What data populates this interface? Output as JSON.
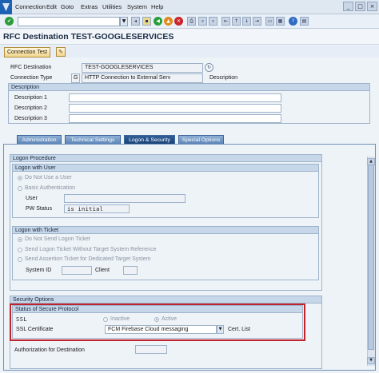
{
  "menu": [
    "Connection",
    "Edit",
    "Goto",
    "Extras",
    "Utilities",
    "System",
    "Help"
  ],
  "window_controls": [
    "minimize-icon",
    "maximize-icon",
    "close-icon"
  ],
  "toolbar": {
    "command_field": "",
    "icons": [
      "enter-icon",
      "save-icon",
      "back-icon",
      "exit-icon",
      "cancel-icon",
      "print-icon",
      "find-icon",
      "find-next-icon",
      "first-page-icon",
      "previous-page-icon",
      "next-page-icon",
      "last-page-icon",
      "new-session-icon",
      "shortcut-icon",
      "help-icon",
      "layout-icon"
    ]
  },
  "title": "RFC Destination TEST-GOOGLESERVICES",
  "app_toolbar": {
    "connection_test": "Connection Test"
  },
  "header": {
    "rfc_destination_label": "RFC Destination",
    "rfc_destination_value": "TEST-GOOGLESERVICES",
    "connection_type_label": "Connection Type",
    "connection_type_code": "G",
    "connection_type_text": "HTTP Connection to External Serv",
    "description_label": "Description"
  },
  "description_group": {
    "title": "Description",
    "fields": [
      {
        "label": "Description 1",
        "value": ""
      },
      {
        "label": "Description 2",
        "value": ""
      },
      {
        "label": "Description 3",
        "value": ""
      }
    ]
  },
  "tabs": [
    {
      "label": "Administration",
      "active": false
    },
    {
      "label": "Technical Settings",
      "active": false
    },
    {
      "label": "Logon & Security",
      "active": true
    },
    {
      "label": "Special Options",
      "active": false
    }
  ],
  "logon_procedure": {
    "title": "Logon Procedure",
    "logon_with_user": {
      "title": "Logon with User",
      "options": [
        {
          "label": "Do Not Use a User",
          "selected": true
        },
        {
          "label": "Basic Authentication",
          "selected": false
        }
      ],
      "user_label": "User",
      "user_value": "",
      "pw_status_label": "PW Status",
      "pw_status_value": "is initial"
    },
    "logon_with_ticket": {
      "title": "Logon with Ticket",
      "options": [
        {
          "label": "Do Not Send Logon Ticket",
          "selected": true
        },
        {
          "label": "Send Logon Ticket Without Target System Reference",
          "selected": false
        },
        {
          "label": "Send Assertion Ticket for Dedicated Target System",
          "selected": false
        }
      ],
      "system_id_label": "System ID",
      "system_id_value": "",
      "client_label": "Client",
      "client_value": ""
    }
  },
  "security_options": {
    "title": "Security Options",
    "status_title": "Status of Secure Protocol",
    "ssl_label": "SSL",
    "ssl_options": [
      {
        "label": "Inactive",
        "selected": false
      },
      {
        "label": "Active",
        "selected": true
      }
    ],
    "ssl_certificate_label": "SSL Certificate",
    "ssl_certificate_value": "FCM Firebase Cloud messaging",
    "cert_list_label": "Cert. List",
    "authorization_label": "Authorization for Destination",
    "authorization_value": ""
  },
  "colors": {
    "highlight_border": "#c0242c",
    "tab_active": "#1a4478",
    "tab_inactive": "#5d86b8",
    "button_bg": "#f1d48c"
  }
}
